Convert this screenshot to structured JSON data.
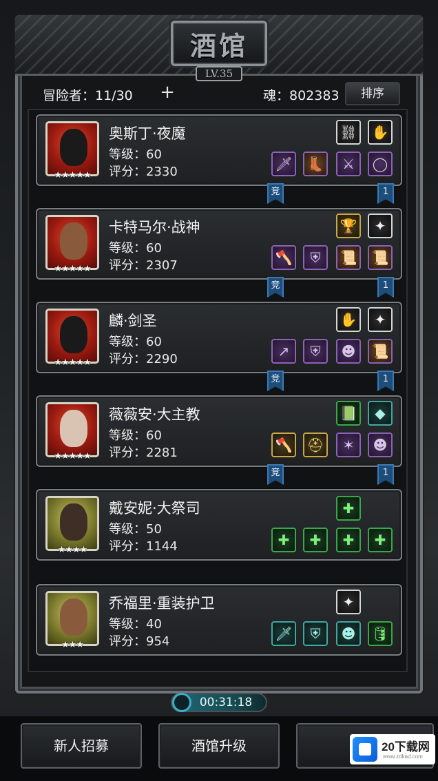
{
  "header": {
    "title": "酒馆",
    "level": "LV.35",
    "adventurers": "冒险者：11/30",
    "add_icon": "plus-icon",
    "souls": "魂：802383",
    "sort_label": "排序"
  },
  "heroes": [
    {
      "name": "奥斯丁·夜魔",
      "level": "等级：60",
      "score": "评分：2330",
      "stars": "★★★★★",
      "portrait": "dark-knight-helmet",
      "tag_left": "竞",
      "tag_right": "1",
      "slots_top": [
        "bracer-icon",
        "gauntlet-icon"
      ],
      "slots_bottom": [
        "dagger-icon",
        "boots-icon",
        "claw-icon",
        "ring-icon"
      ]
    },
    {
      "name": "卡特马尔·战神",
      "level": "等级：60",
      "score": "评分：2307",
      "stars": "★★★★★",
      "portrait": "warrior-face",
      "tag_left": "竞",
      "tag_right": "1",
      "slots_top": [
        "trophy-icon",
        "claw-mark-icon"
      ],
      "slots_bottom": [
        "axe-icon",
        "armor-icon",
        "scroll-icon",
        "scroll-icon"
      ]
    },
    {
      "name": "麟·剑圣",
      "level": "等级：60",
      "score": "评分：2290",
      "stars": "★★★★★",
      "portrait": "masked-swordsman",
      "tag_left": "竞",
      "tag_right": "1",
      "slots_top": [
        "gauntlet-icon",
        "claw-mark-icon"
      ],
      "slots_bottom": [
        "spear-icon",
        "armor-icon",
        "mask-icon",
        "scroll-icon"
      ]
    },
    {
      "name": "薇薇安·大主教",
      "level": "等级：60",
      "score": "评分：2281",
      "stars": "★★★★★",
      "portrait": "archbishop-woman",
      "tag_left": "竞",
      "tag_right": "1",
      "slots_top": [
        "tome-icon",
        "crystal-icon"
      ],
      "slots_bottom": [
        "axe-icon",
        "helmet-icon",
        "star-icon",
        "mask-icon"
      ]
    },
    {
      "name": "戴安妮·大祭司",
      "level": "等级：50",
      "score": "评分：1144",
      "stars": "★★★★",
      "portrait": "priestess-hooded",
      "tag_left": "",
      "tag_right": "",
      "slots_top": [
        "add-slot-icon"
      ],
      "slots_bottom": [
        "add-slot-icon",
        "add-slot-icon",
        "add-slot-icon",
        "add-slot-icon"
      ]
    },
    {
      "name": "乔福里·重装护卫",
      "level": "等级：40",
      "score": "评分：954",
      "stars": "★★★",
      "portrait": "armored-guard",
      "tag_left": "",
      "tag_right": "",
      "slots_top": [
        "claw-mark-icon"
      ],
      "slots_bottom": [
        "blade-icon",
        "armor-icon",
        "mask-icon",
        "barrel-icon"
      ]
    }
  ],
  "timer": "00:31:18",
  "bottom": {
    "recruit": "新人招募",
    "upgrade": "酒馆升级"
  },
  "watermark": {
    "brand": "20下载网",
    "url": "www.zdkad.com"
  }
}
